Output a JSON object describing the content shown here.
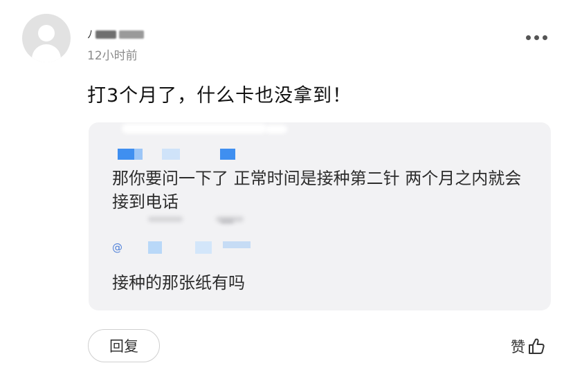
{
  "comment": {
    "username_visible": "ﾉ",
    "timestamp": "12小时前",
    "text": "打3个月了，什么卡也没拿到！"
  },
  "reply": {
    "text": "那你要问一下了 正常时间是接种第二针 两个月之内就会接到电话",
    "mention_prefix": "@",
    "text_2": "接种的那张纸有吗"
  },
  "actions": {
    "reply_label": "回复",
    "like_label": "赞"
  },
  "icons": {
    "more": "more-dots-icon",
    "like": "thumbs-up-icon",
    "avatar": "default-avatar-icon"
  },
  "colors": {
    "reply_box_bg": "#f2f2f4",
    "timestamp": "#8a8a8a",
    "mention": "#4d7fd8"
  }
}
